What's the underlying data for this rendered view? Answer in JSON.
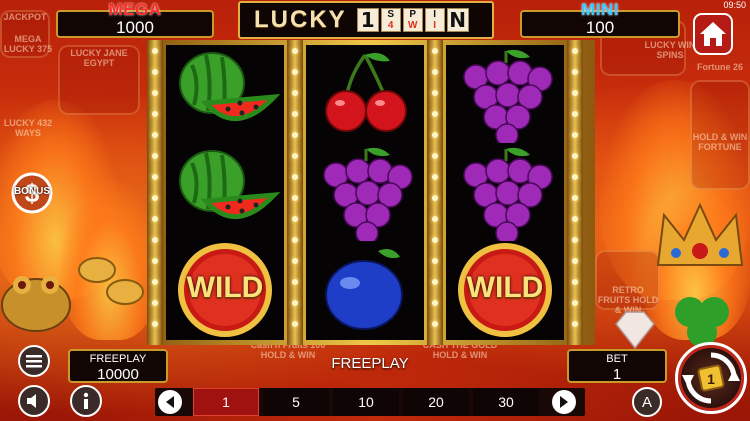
{
  "status_bar": {
    "time": "09:50"
  },
  "jackpots": {
    "mega": {
      "label": "MEGA",
      "value": "1000"
    },
    "mini": {
      "label": "MINI",
      "value": "100"
    }
  },
  "logo": {
    "word": "LUCKY",
    "tile_big": "1",
    "tiles_top": [
      "S",
      "P",
      "I"
    ],
    "tiles_bottom": [
      "4",
      "W",
      "I"
    ],
    "tile_last": "N"
  },
  "background_labels": {
    "left_top": "JACKPOT",
    "left_mega": "MEGA LUCKY 375",
    "left_jane": "LUCKY JANE EGYPT",
    "left_lucky": "LUCKY 432 WAYS",
    "right_lucky": "LUCKY WIN SPINS",
    "right_fortune": "Fortune 26",
    "right_holdwin": "HOLD & WIN FORTUNE",
    "right_retro": "RETRO FRUITS HOLD & WIN",
    "bottom_cash": "Cash'n Fruits 100 HOLD & WIN",
    "bottom_gold": "CASH THE GOLD HOLD & WIN"
  },
  "reels": [
    [
      "watermelon",
      "watermelon",
      "wild"
    ],
    [
      "cherry",
      "grapes",
      "plum"
    ],
    [
      "grapes",
      "grapes",
      "wild"
    ]
  ],
  "wild_label": "WILD",
  "bonus_label": "BONUS",
  "freeplay_box": {
    "caption": "FREEPLAY",
    "value": "10000"
  },
  "freeplay_center": "FREEPLAY",
  "bet_box": {
    "caption": "BET",
    "value": "1"
  },
  "bet_options": [
    "1",
    "5",
    "10",
    "20",
    "30"
  ],
  "selected_bet": "1",
  "auto_label": "A",
  "icons": {
    "home": "home-icon",
    "menu": "hamburger-icon",
    "sound": "speaker-icon",
    "info": "info-icon",
    "prev": "arrow-left-icon",
    "next": "arrow-right-icon",
    "spin": "spin-icon"
  },
  "colors": {
    "mega": "#ff2a2a",
    "mini": "#38c8ff",
    "selected_bet": "#a01210",
    "gold": "#c99a2a"
  }
}
